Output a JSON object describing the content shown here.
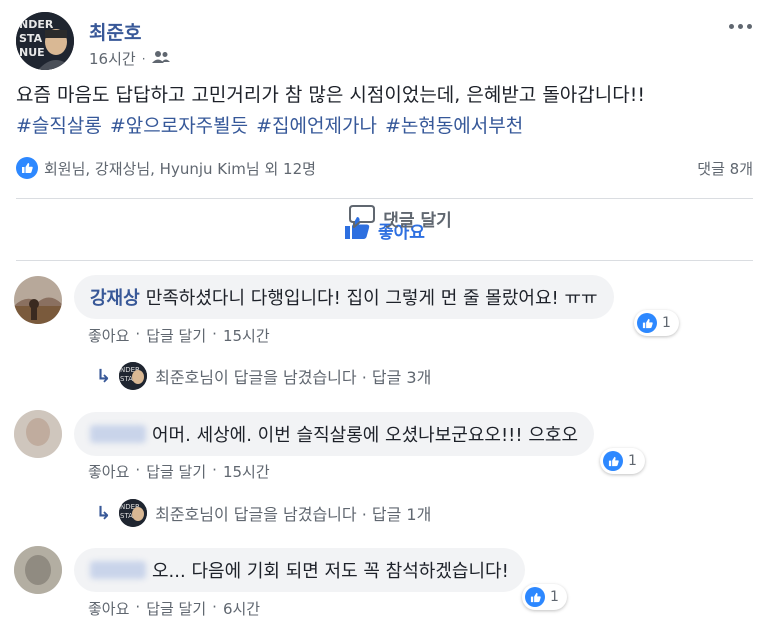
{
  "post": {
    "author": "최준호",
    "time": "16시간",
    "separator": "·",
    "text": "요즘 마음도 답답하고 고민거리가 참 많은 시점이었는데, 은혜받고 돌아갑니다!!",
    "hashtags": [
      "#슬직살롱",
      "#앞으로자주뵐듯",
      "#집에언제가나",
      "#논현동에서부천"
    ],
    "likes_summary": "회원님, 강재상님, Hyunju Kim님 외 12명",
    "comment_count": "댓글 8개"
  },
  "actions": {
    "like": "좋아요",
    "comment": "댓글 달기"
  },
  "comments": [
    {
      "name": "강재상",
      "text": "만족하셨다니 다행입니다! 집이 그렇게 먼 줄 몰랐어요! ㅠㅠ",
      "reaction_count": "1",
      "like": "좋아요",
      "reply": "답글 달기",
      "time": "15시간",
      "reply_summary": "최준호님이 답글을 남겼습니다 · 답글 3개"
    },
    {
      "name": "",
      "text": "어머. 세상에. 이번 슬직살롱에 오셨나보군요오!!! 으호오",
      "reaction_count": "1",
      "like": "좋아요",
      "reply": "답글 달기",
      "time": "15시간",
      "reply_summary": "최준호님이 답글을 남겼습니다 · 답글 1개"
    },
    {
      "name": "",
      "text": "오... 다음에 기회 되면 저도 꼭 참석하겠습니다!",
      "reaction_count": "1",
      "like": "좋아요",
      "reply": "답글 달기",
      "time": "6시간"
    }
  ],
  "sep": "·",
  "icons": {
    "privacy": "friends-icon",
    "more": "more-options-icon",
    "like": "thumbs-up-icon",
    "comment": "comment-bubble-icon",
    "reply": "reply-arrow-icon"
  },
  "colors": {
    "link": "#385898",
    "accent": "#2d88ff",
    "bubble": "#f2f3f5"
  }
}
